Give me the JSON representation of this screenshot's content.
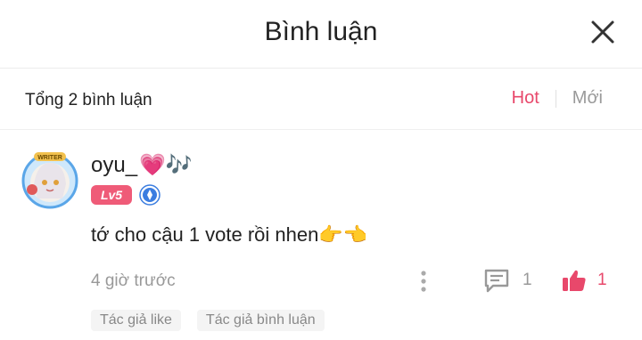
{
  "header": {
    "title": "Bình luận"
  },
  "subbar": {
    "total": "Tổng 2 bình luận",
    "sort_hot": "Hot",
    "sort_new": "Mới"
  },
  "comment": {
    "username": "oyu_",
    "username_emoji": "💗🎶",
    "avatar_badge": "WRITER",
    "level": "Lv5",
    "text": "tớ cho cậu 1 vote rồi nhen👉👈",
    "time": "4 giờ trước",
    "reply_count": "1",
    "like_count": "1",
    "tags": [
      "Tác giả like",
      "Tác giả bình luận"
    ]
  },
  "colors": {
    "accent": "#e8486b",
    "level_badge": "#ef5b78",
    "muted": "#999999"
  },
  "icons": [
    "close-icon",
    "more-vertical-icon",
    "reply-icon",
    "thumbs-up-icon",
    "vip-badge-icon"
  ]
}
